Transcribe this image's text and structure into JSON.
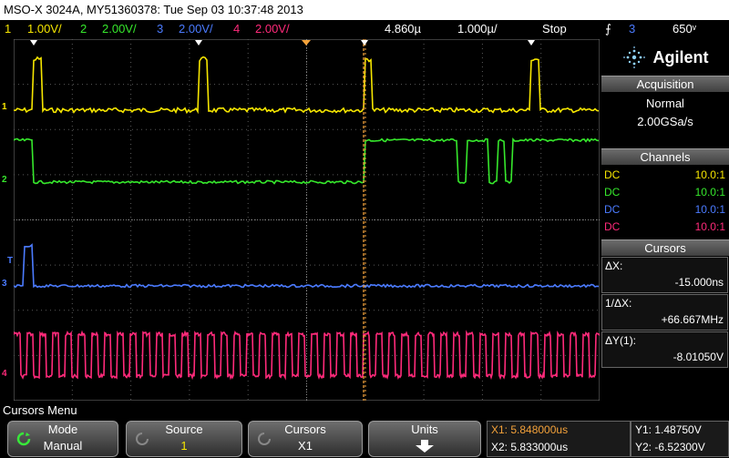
{
  "title": "MSO-X 3024A, MY51360378: Tue Sep 03 10:37:48 2013",
  "status": {
    "ch1": {
      "num": "1",
      "scale": "1.00V/",
      "color": "#f6e600"
    },
    "ch2": {
      "num": "2",
      "scale": "2.00V/",
      "color": "#36e82c"
    },
    "ch3": {
      "num": "3",
      "scale": "2.00V/",
      "color": "#4b7bff"
    },
    "ch4": {
      "num": "4",
      "scale": "2.00V/",
      "color": "#ff2a7a"
    },
    "delay": "4.860µ",
    "timebase": "1.000µ/",
    "run_state": "Stop",
    "trigger_source": "3",
    "trigger_level": "650ᵛ"
  },
  "brand": "Agilent",
  "acquisition": {
    "header": "Acquisition",
    "mode": "Normal",
    "rate": "2.00GSa/s"
  },
  "channels": {
    "header": "Channels",
    "rows": [
      {
        "coupling": "DC",
        "probe": "10.0:1",
        "color": "#f6e600"
      },
      {
        "coupling": "DC",
        "probe": "10.0:1",
        "color": "#36e82c"
      },
      {
        "coupling": "DC",
        "probe": "10.0:1",
        "color": "#4b7bff"
      },
      {
        "coupling": "DC",
        "probe": "10.0:1",
        "color": "#ff2a7a"
      }
    ]
  },
  "cursors": {
    "header": "Cursors",
    "dx_label": "ΔX:",
    "dx_value": "-15.000ns",
    "inv_label": "1/ΔX:",
    "inv_value": "+66.667MHz",
    "dy_label": "ΔY(1):",
    "dy_value": "-8.01050V"
  },
  "menu_title": "Cursors Menu",
  "softkeys": {
    "mode": {
      "label": "Mode",
      "value": "Manual"
    },
    "source": {
      "label": "Source",
      "value": "1"
    },
    "cursors": {
      "label": "Cursors",
      "value": "X1"
    },
    "units": {
      "label": "Units"
    }
  },
  "readouts": {
    "x1": "X1: 5.848000us",
    "x2": "X2: 5.833000us",
    "y1": "Y1: 1.48750V",
    "y2": "Y2: -6.52300V"
  },
  "markers": {
    "ch1": "1",
    "ch2": "2",
    "ch3": "3",
    "ch4": "4",
    "trig": "T"
  }
}
